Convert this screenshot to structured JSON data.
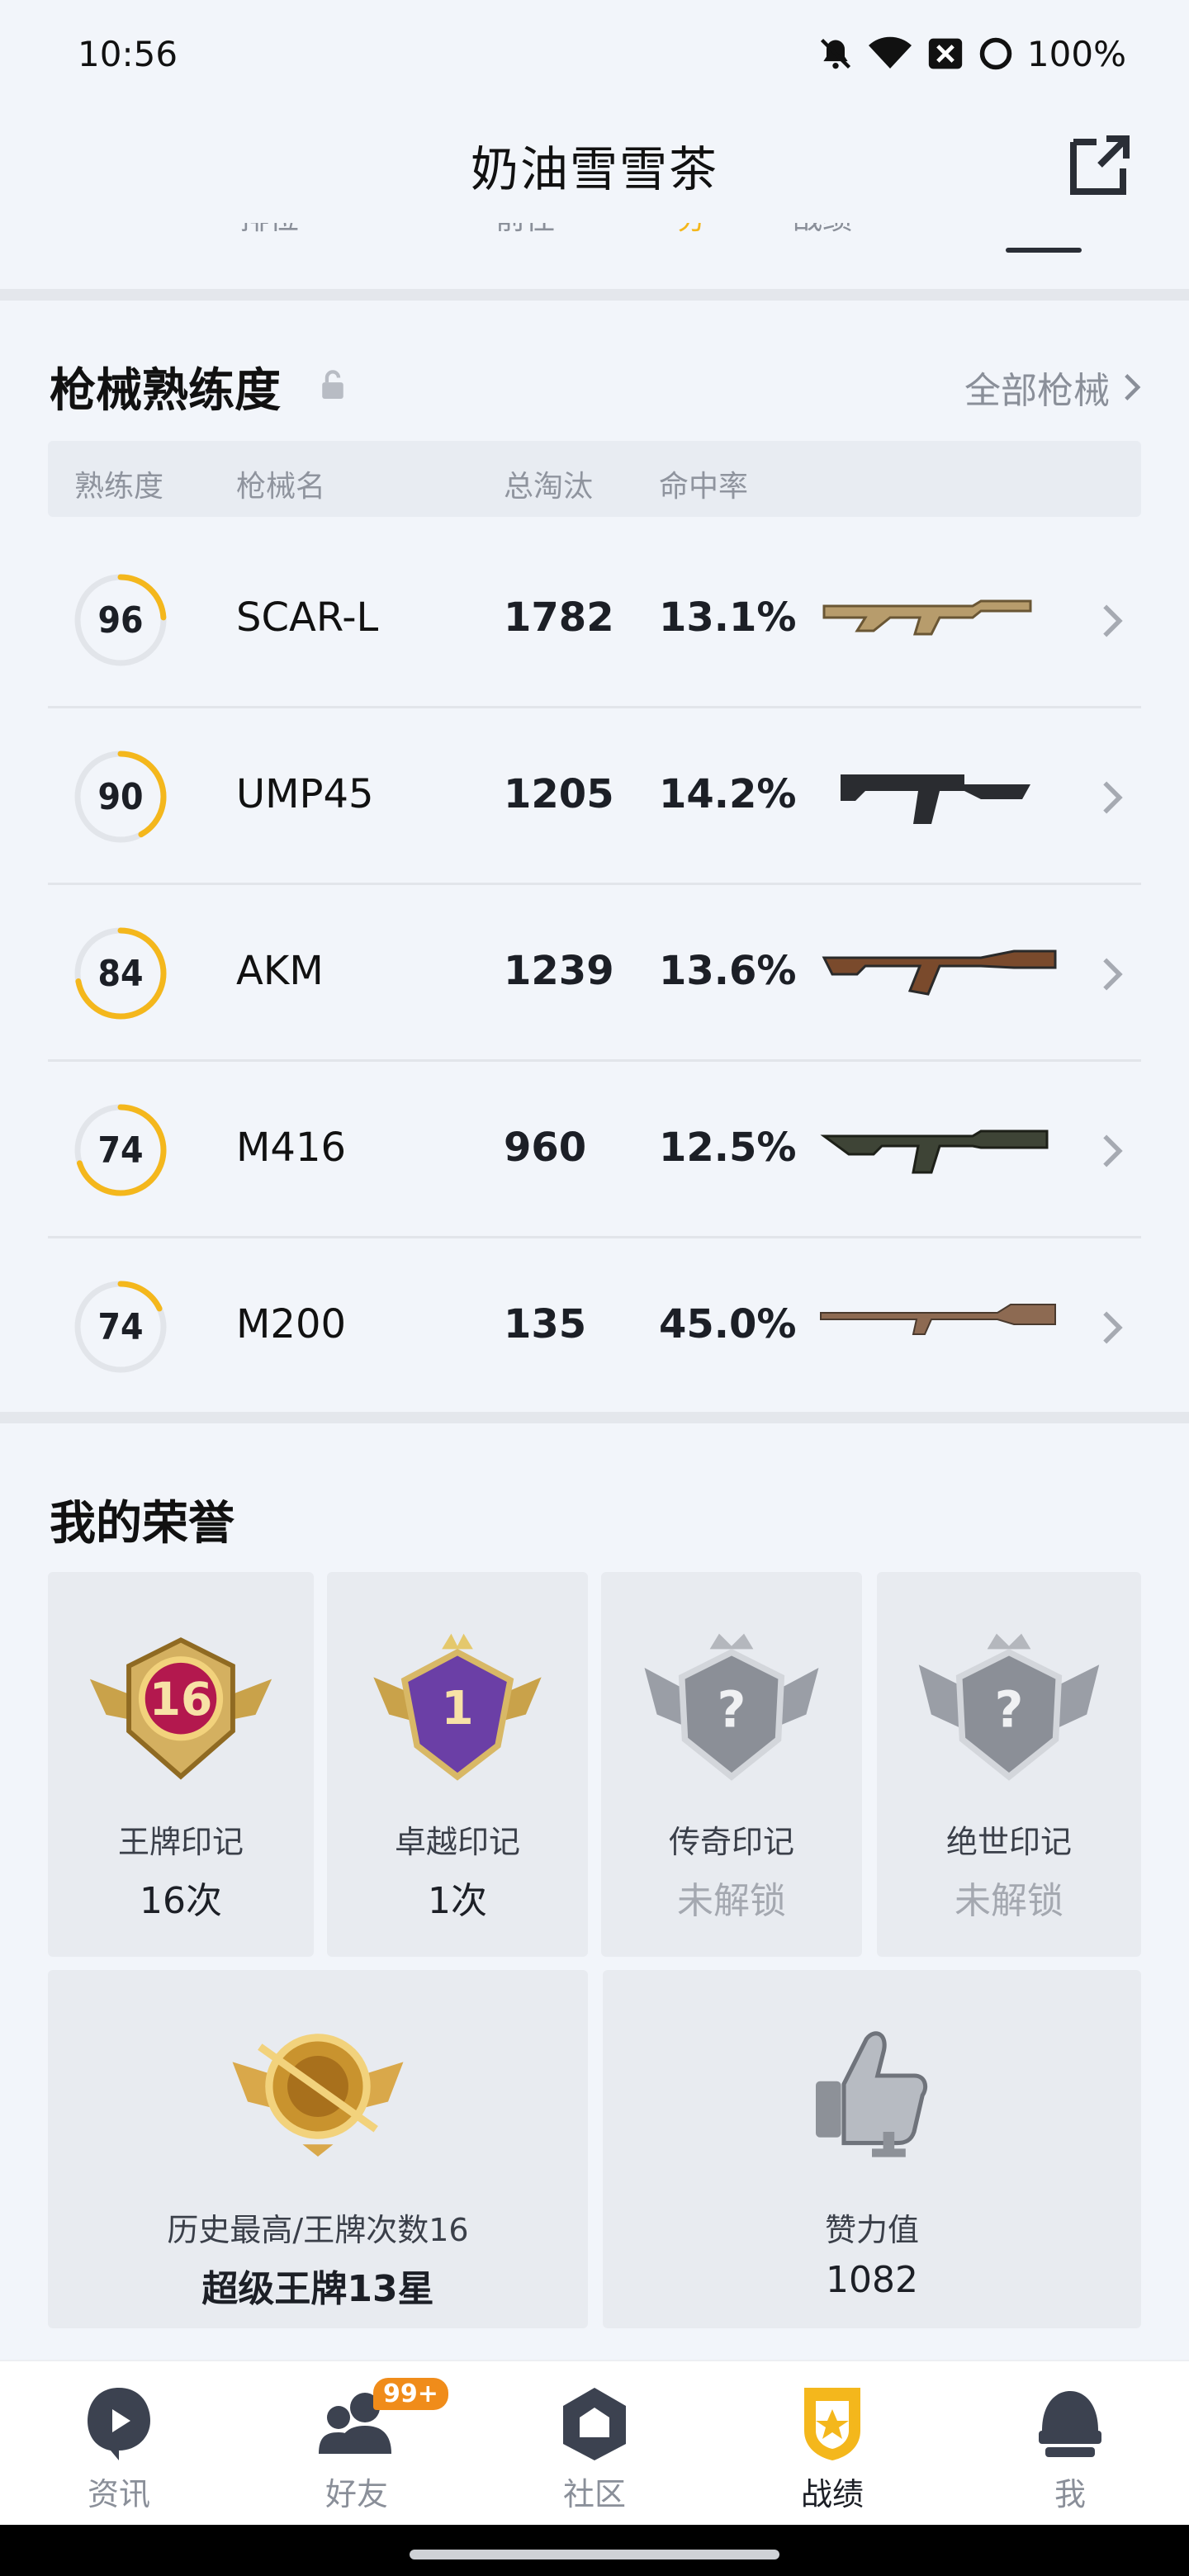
{
  "status_bar": {
    "time": "10:56",
    "battery": "100%",
    "icons": [
      "mute-bell-icon",
      "wifi-icon",
      "notification-x-icon",
      "circle-icon"
    ]
  },
  "header": {
    "title": "奶油雪雪茶",
    "share_icon": "share-external-icon"
  },
  "cut_tabs": [
    "排位",
    "前往",
    "分",
    "战绩"
  ],
  "gun_section": {
    "title": "枪械熟练度",
    "all_guns_label": "全部枪械",
    "columns": [
      "熟练度",
      "枪械名",
      "总淘汰",
      "命中率"
    ],
    "rows": [
      {
        "proficiency": "96",
        "progress": 0.24,
        "name": "SCAR-L",
        "kills": "1782",
        "hit_rate": "13.1%",
        "gun_icon": "scar-l-rifle-icon"
      },
      {
        "proficiency": "90",
        "progress": 0.42,
        "name": "UMP45",
        "kills": "1205",
        "hit_rate": "14.2%",
        "gun_icon": "ump45-smg-icon"
      },
      {
        "proficiency": "84",
        "progress": 0.72,
        "name": "AKM",
        "kills": "1239",
        "hit_rate": "13.6%",
        "gun_icon": "akm-rifle-icon"
      },
      {
        "proficiency": "74",
        "progress": 0.7,
        "name": "M416",
        "kills": "960",
        "hit_rate": "12.5%",
        "gun_icon": "m416-rifle-icon"
      },
      {
        "proficiency": "74",
        "progress": 0.18,
        "name": "M200",
        "kills": "135",
        "hit_rate": "45.0%",
        "gun_icon": "m200-sniper-icon"
      }
    ]
  },
  "honor_section": {
    "title": "我的荣誉",
    "cards": [
      {
        "label": "王牌印记",
        "value": "16次",
        "badge_text": "16",
        "locked": false,
        "icon": "ace-mark-badge-icon"
      },
      {
        "label": "卓越印记",
        "value": "1次",
        "badge_text": "1",
        "locked": false,
        "icon": "excellence-mark-badge-icon"
      },
      {
        "label": "传奇印记",
        "value": "未解锁",
        "badge_text": "?",
        "locked": true,
        "icon": "legend-mark-badge-icon"
      },
      {
        "label": "绝世印记",
        "value": "未解锁",
        "badge_text": "?",
        "locked": true,
        "icon": "peerless-mark-badge-icon"
      }
    ],
    "wide_cards": [
      {
        "label": "历史最高/王牌次数16",
        "value": "超级王牌13星",
        "icon": "super-ace-emblem-icon"
      },
      {
        "label": "赞力值",
        "value": "1082",
        "icon": "thumbs-up-trophy-icon"
      }
    ]
  },
  "bottom_nav": {
    "items": [
      {
        "label": "资讯",
        "icon": "news-play-icon",
        "active": false
      },
      {
        "label": "好友",
        "icon": "friends-icon",
        "active": false,
        "badge": "99+"
      },
      {
        "label": "社区",
        "icon": "community-house-icon",
        "active": false
      },
      {
        "label": "战绩",
        "icon": "record-shield-icon",
        "active": true
      },
      {
        "label": "我",
        "icon": "helmet-icon",
        "active": false
      }
    ]
  },
  "colors": {
    "accent_yellow": "#f4b71c",
    "badge_orange": "#f08c1a",
    "background": "#f2f5fa",
    "card": "#e8ebf0"
  }
}
